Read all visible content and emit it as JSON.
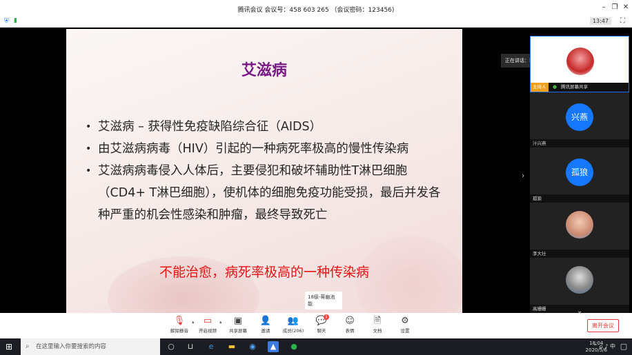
{
  "window": {
    "title": "腾讯会议 会议号：458 603 265 （会议密码：123456)"
  },
  "status": {
    "time": "13:47"
  },
  "slide": {
    "title": "艾滋病",
    "bullets": [
      "艾滋病 – 获得性免疫缺陷综合征（AIDS）",
      "由艾滋病病毒（HIV）引起的一种病死率极高的慢性传染病",
      "艾滋病病毒侵入人体后，主要侵犯和破坏辅助性T淋巴细胞（CD4+ T淋巴细胞），使机体的细胞免疫功能受损，最后并发各种严重的机会性感染和肿瘤，最终导致死亡"
    ],
    "callout": "不能治愈，病死率极高的一种传染病",
    "speaker_tag": "18级-蒋幽池能"
  },
  "speaking_banner": "正在讲话：蒋",
  "participants": [
    {
      "name": "蒋幽池能",
      "role": "主持人",
      "status": "腾讯屏幕共享",
      "avatar": "photo"
    },
    {
      "name": "汁兴燕",
      "avatar_text": "兴燕"
    },
    {
      "name": "孤狼",
      "avatar_text": "孤狼"
    },
    {
      "name": "李大壮",
      "avatar": "photo"
    },
    {
      "name": "高姗姗",
      "avatar": "photo"
    }
  ],
  "toolbar": {
    "items": [
      {
        "label": "解除静音",
        "icon": "mic-muted-icon"
      },
      {
        "label": "开启视频",
        "icon": "camera-off-icon"
      },
      {
        "label": "共享屏幕",
        "icon": "screen-share-icon"
      },
      {
        "label": "邀请",
        "icon": "invite-icon"
      },
      {
        "label": "成员(206)",
        "icon": "members-icon"
      },
      {
        "label": "聊天",
        "icon": "chat-icon",
        "badge": "1"
      },
      {
        "label": "表情",
        "icon": "emoji-icon"
      },
      {
        "label": "文档",
        "icon": "document-icon"
      },
      {
        "label": "设置",
        "icon": "settings-icon"
      }
    ],
    "leave": "离开会议"
  },
  "taskbar": {
    "search_placeholder": "在这里输入你要搜索的内容",
    "ime": "中",
    "time": "18:04",
    "date": "2020/5/6"
  }
}
